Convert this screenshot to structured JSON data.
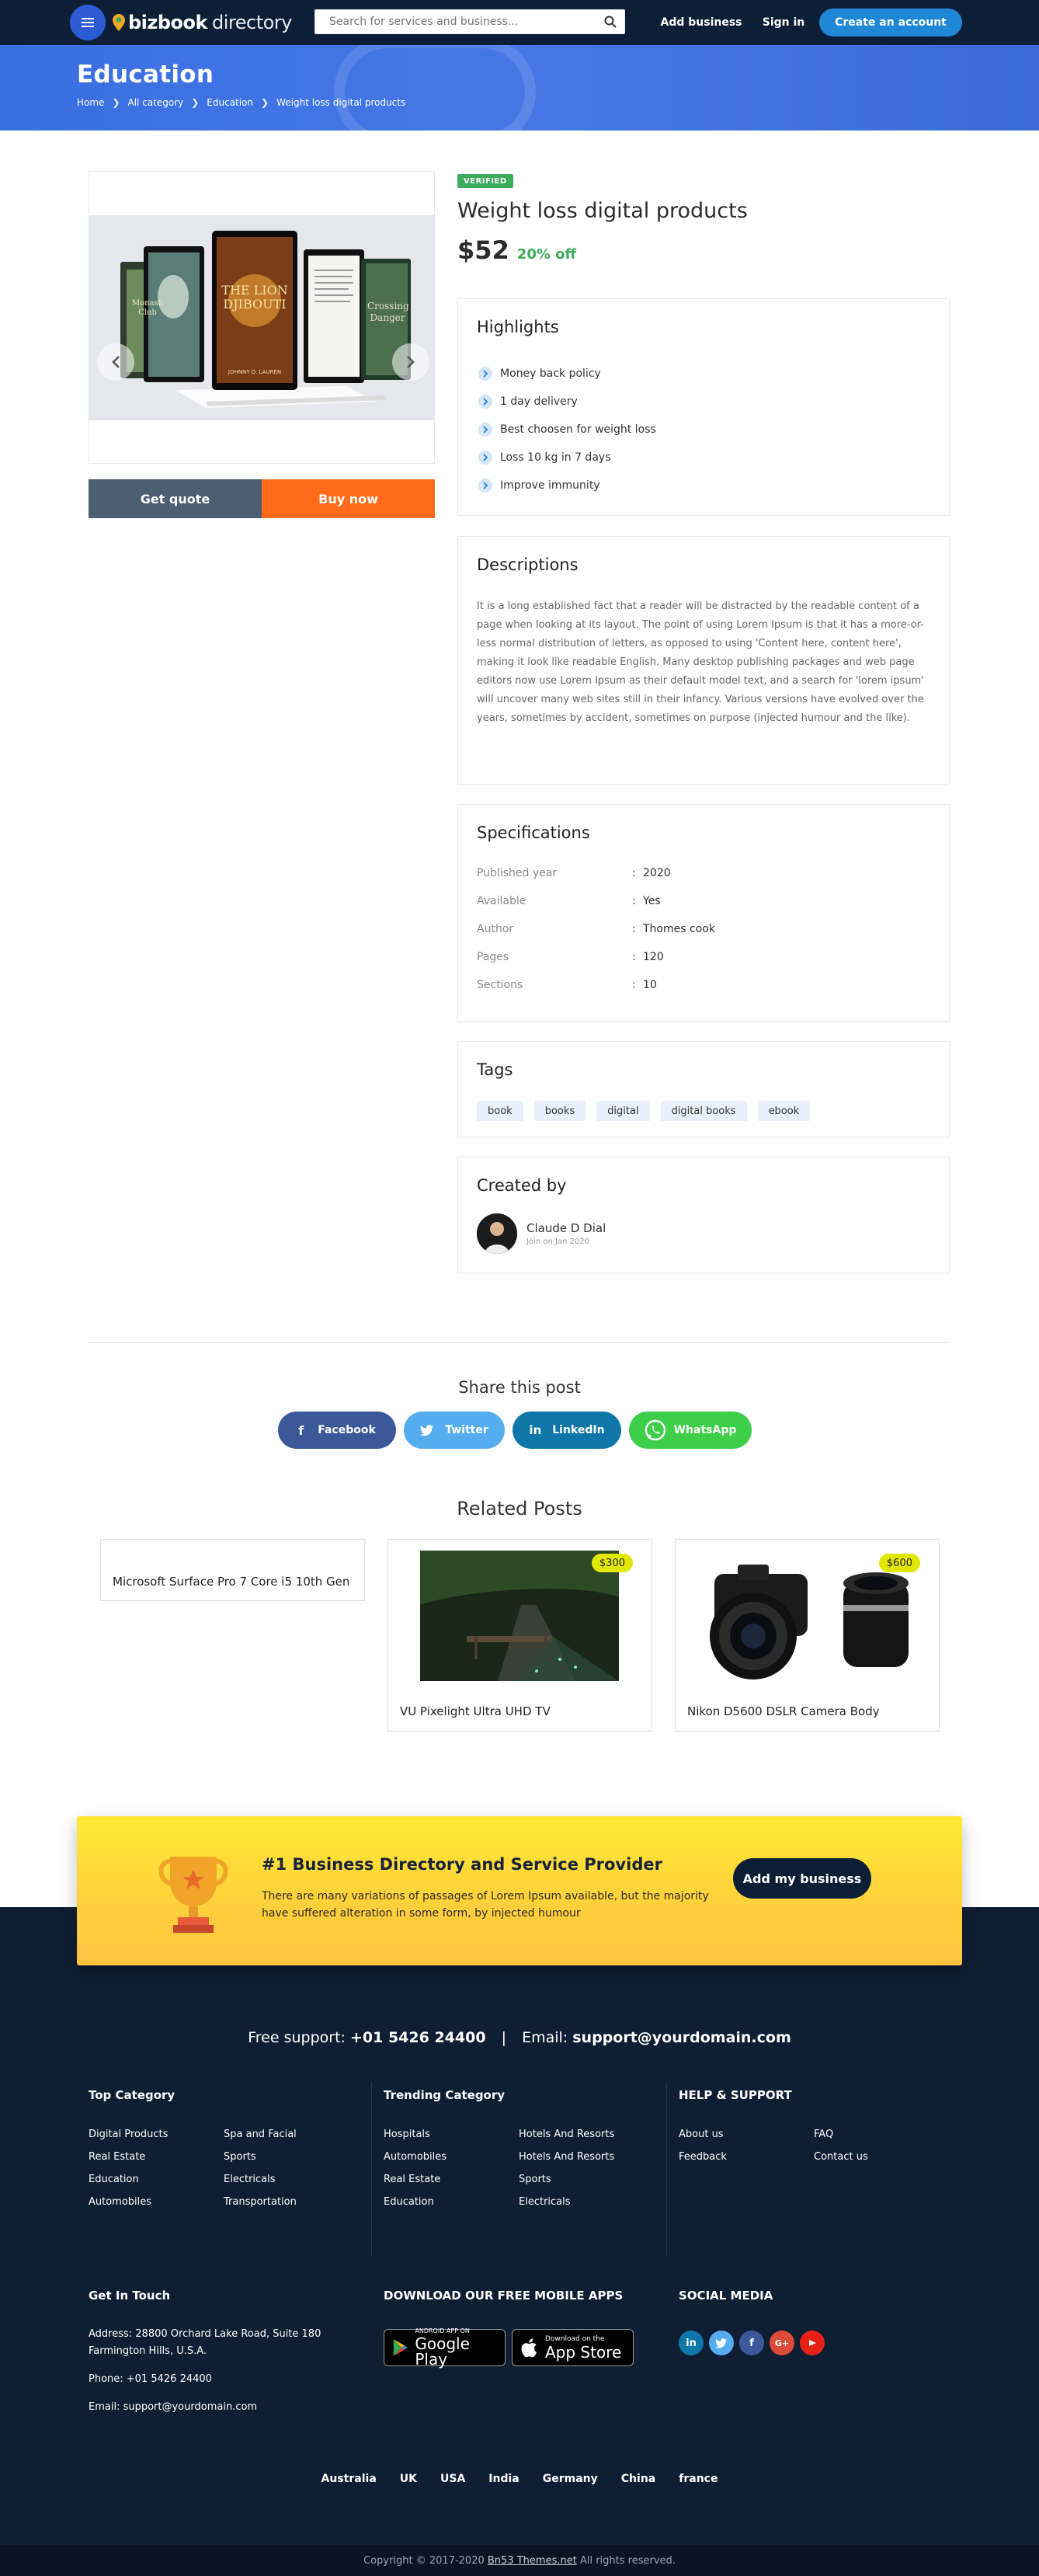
{
  "header": {
    "logo_bold": "bizbook",
    "logo_light": "directory",
    "search_placeholder": "Search for services and business...",
    "add_business": "Add business",
    "sign_in": "Sign in",
    "create_account": "Create an account"
  },
  "hero": {
    "title": "Education",
    "breadcrumbs": [
      "Home",
      "All category",
      "Education",
      "Weight loss digital products"
    ]
  },
  "gallery": {
    "book_titles": [
      "Monash Club",
      "THE LION DJIBOUTI",
      "Crossing Danger"
    ],
    "book_author": "JOHNNY D. LAUREN",
    "quote_button": "Get quote",
    "buy_button": "Buy now"
  },
  "product": {
    "badge": "VERIFIED",
    "title": "Weight loss digital products",
    "price": "$52",
    "discount": "20% off"
  },
  "highlights": {
    "title": "Highlights",
    "items": [
      "Money back policy",
      "1 day delivery",
      "Best choosen for weight loss",
      "Loss 10 kg in 7 days",
      "Improve immunity"
    ]
  },
  "descriptions": {
    "title": "Descriptions",
    "text": "It is a long established fact that a reader will be distracted by the readable content of a page when looking at its layout. The point of using Lorem Ipsum is that it has a more-or-less normal distribution of letters, as opposed to using 'Content here, content here', making it look like readable English. Many desktop publishing packages and web page editors now use Lorem Ipsum as their default model text, and a search for 'lorem ipsum' will uncover many web sites still in their infancy. Various versions have evolved over the years, sometimes by accident, sometimes on purpose (injected humour and the like)."
  },
  "specifications": {
    "title": "Specifications",
    "rows": [
      {
        "key": "Published year",
        "value": "2020"
      },
      {
        "key": "Available",
        "value": "Yes"
      },
      {
        "key": "Author",
        "value": "Thomes cook"
      },
      {
        "key": "Pages",
        "value": "120"
      },
      {
        "key": "Sections",
        "value": "10"
      }
    ]
  },
  "tags": {
    "title": "Tags",
    "items": [
      "book",
      "books",
      "digital",
      "digital books",
      "ebook"
    ]
  },
  "created_by": {
    "title": "Created by",
    "name": "Claude D Dial",
    "joined": "Join on Jan 2020"
  },
  "share": {
    "title": "Share this post",
    "facebook": "Facebook",
    "twitter": "Twitter",
    "linkedin": "LinkedIn",
    "whatsapp": "WhatsApp"
  },
  "related": {
    "title": "Related Posts",
    "items": [
      {
        "title": "Microsoft Surface Pro 7 Core i5 10th Gen",
        "price": ""
      },
      {
        "title": "VU Pixelight Ultra UHD TV",
        "price": "$300"
      },
      {
        "title": "Nikon D5600 DSLR Camera Body",
        "price": "$600"
      }
    ]
  },
  "cta": {
    "title": "#1 Business Directory and Service Provider",
    "text": "There are many variations of passages of Lorem Ipsum available, but the majority have suffered alteration in some form, by injected humour",
    "button": "Add my business"
  },
  "footer": {
    "support_label": "Free support:",
    "support_phone": "+01 5426 24400",
    "email_label": "Email:",
    "support_email": "support@yourdomain.com",
    "top_category": {
      "title": "Top Category",
      "links": [
        "Digital Products",
        "Spa and Facial",
        "Real Estate",
        "Sports",
        "Education",
        "Electricals",
        "Automobiles",
        "Transportation"
      ]
    },
    "trending_category": {
      "title": "Trending Category",
      "links": [
        "Hospitals",
        "Hotels And Resorts",
        "Automobiles",
        "Hotels And Resorts",
        "Real Estate",
        "Sports",
        "Education",
        "Electricals"
      ]
    },
    "help": {
      "title": "HELP & SUPPORT",
      "links": [
        "About us",
        "FAQ",
        "Feedback",
        "Contact us"
      ]
    },
    "get_in_touch": {
      "title": "Get In Touch",
      "address": "Address: 28800 Orchard Lake Road, Suite 180 Farmington Hills, U.S.A.",
      "phone": "Phone: +01 5426 24400",
      "email": "Email: support@yourdomain.com"
    },
    "apps": {
      "title": "DOWNLOAD OUR FREE MOBILE APPS",
      "google_small": "ANDROID APP ON",
      "google_big": "Google Play",
      "apple_small": "Download on the",
      "apple_big": "App Store"
    },
    "social": {
      "title": "SOCIAL MEDIA",
      "icons": [
        "linkedin-icon",
        "twitter-icon",
        "facebook-icon",
        "google-plus-icon",
        "youtube-icon"
      ],
      "colors": [
        "#0e76a8",
        "#55acee",
        "#3b5999",
        "#dd4b39",
        "#e62117"
      ]
    },
    "countries": [
      "Australia",
      "UK",
      "USA",
      "India",
      "Germany",
      "China",
      "france"
    ],
    "copyright_prefix": "Copyright © 2017-2020",
    "copyright_link": "Bn53 Themes.net",
    "copyright_suffix": "All rights reserved."
  },
  "colors": {
    "navy": "#0d1f36",
    "hero_blue": "#4677e6",
    "accent_blue": "#1e88d6",
    "orange": "#ff6b1a",
    "green": "#3cab5c",
    "yellow": "#ffd23a"
  }
}
